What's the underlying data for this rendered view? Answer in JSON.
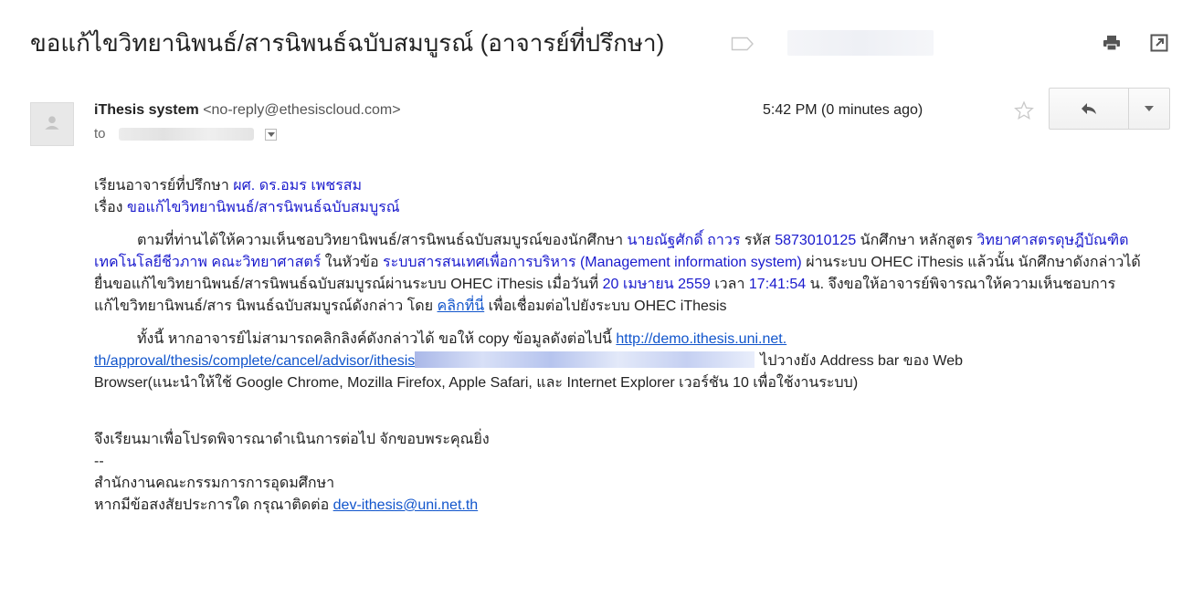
{
  "email": {
    "subject": "ขอแก้ไขวิทยานิพนธ์/สารนิพนธ์ฉบับสมบูรณ์ (อาจารย์ที่ปรึกษา)",
    "sender_name": "iThesis system",
    "sender_email": "<no-reply@ethesiscloud.com>",
    "to_label": "to",
    "timestamp": "5:42 PM (0 minutes ago)"
  },
  "icons": {
    "label": "label-tag-icon",
    "print": "print-icon",
    "popout": "new-window-icon",
    "star": "star-icon",
    "reply": "reply-icon",
    "more": "chevron-down-icon",
    "avatar": "person-icon"
  },
  "body": {
    "greeting_prefix": "เรียนอาจารย์ที่ปรึกษา",
    "advisor_name": "ผศ. ดร.อมร เพชรสม",
    "subject_prefix": "เรื่อง",
    "subject_value": "ขอแก้ไขวิทยานิพนธ์/สารนิพนธ์ฉบับสมบูรณ์",
    "p1_a": "ตามที่ท่านได้ให้ความเห็นชอบวิทยานิพนธ์/สารนิพนธ์ฉบับสมบูรณ์ของนักศึกษา",
    "student_name": "นายณัฐศักดิ์ ถาวร",
    "p1_b": "รหัส",
    "student_id": "5873010125",
    "p1_c": "นักศึกษา",
    "p1_d": "หลักสูตร",
    "program": "วิทยาศาสตรดุษฎีบัณฑิต เทคโนโลยีชีวภาพ คณะวิทยาศาสตร์",
    "p1_e": "ในหัวข้อ",
    "thesis_title": "ระบบสารสนเทศเพื่อการบริหาร (Management information system)",
    "p1_f": "ผ่านระบบ OHEC iThesis แล้วนั้น นักศึกษาดังกล่าวได้ยื่นขอแก้ไขวิทยานิพนธ์/สารนิพนธ์ฉบับสมบูรณ์ผ่านระบบ OHEC iThesis เมื่อวันที่",
    "date": "20 เมษายน 2559",
    "p1_g": "เวลา",
    "time": "17:41:54",
    "p1_h": "น. จึงขอให้อาจารย์พิจารณาให้ความเห็นชอบการแก้ไขวิทยานิพนธ์/สาร นิพนธ์ฉบับสมบูรณ์ดังกล่าว โดย",
    "click_here": "คลิกที่นี่",
    "p1_i": "เพื่อเชื่อมต่อไปยังระบบ OHEC iThesis",
    "p2_a": "ทั้งนี้ หากอาจารย์ไม่สามารถคลิกลิงค์ดังกล่าวได้ ขอให้ copy ข้อมูลดังต่อไปนี้",
    "url_line1": "http://demo.ithesis.uni.net.",
    "url_line2": "th/approval/thesis/complete/cancel/advisor/ithesis",
    "p2_b": "ไปวางยัง Address bar ของ Web",
    "p2_c": "Browser(แนะนำให้ใช้ Google Chrome, Mozilla Firefox, Apple Safari, และ Internet Explorer เวอร์ชัน 10 เพื่อใช้งานระบบ)",
    "closing": "จึงเรียนมาเพื่อโปรดพิจารณาดำเนินการต่อไป จักขอบพระคุณยิ่ง",
    "separator": "--",
    "org": "สำนักงานคณะกรรมการการอุดมศึกษา",
    "contact_prefix": "หากมีข้อสงสัยประการใด กรุณาติดต่อ",
    "contact_email": "dev-ithesis@uni.net.th"
  },
  "colors": {
    "highlight": "#1a1acd",
    "link": "#1155cc",
    "text": "#222222"
  }
}
